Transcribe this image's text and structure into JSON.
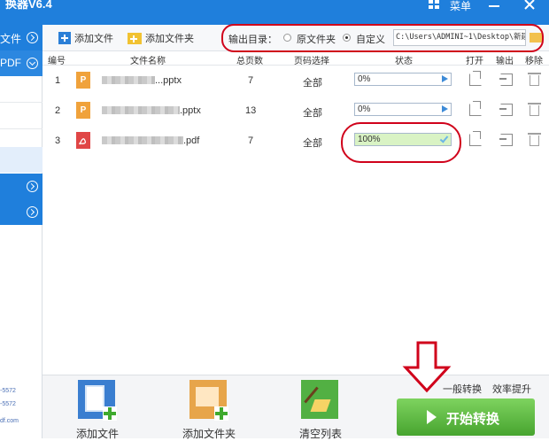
{
  "window": {
    "title_fragment": "换器V6.4",
    "menu_label": "菜单"
  },
  "sidebar": {
    "items": [
      {
        "label": "文件",
        "expand": "right"
      },
      {
        "label": "PDF",
        "expand": "down"
      }
    ],
    "collapsed_items": [
      {},
      {}
    ],
    "footer_lines": [
      "-5572",
      "-5572",
      "df.com"
    ]
  },
  "toolbar": {
    "add_file_label": "添加文件",
    "add_folder_label": "添加文件夹",
    "output_dir_label": "输出目录：",
    "option_source_folder": "原文件夹",
    "option_custom": "自定义",
    "output_path": "C:\\Users\\ADMINI~1\\Desktop\\新建文"
  },
  "table": {
    "headers": {
      "index": "编号",
      "filename": "文件名称",
      "pages": "总页数",
      "page_select": "页码选择",
      "status": "状态",
      "open": "打开",
      "export": "输出",
      "remove": "移除"
    },
    "rows": [
      {
        "index": "1",
        "type": "P",
        "name_suffix": "...pptx",
        "pages": "7",
        "page_select": "全部",
        "status": "0%",
        "progress": 0,
        "done": false
      },
      {
        "index": "2",
        "type": "P",
        "name_suffix": ".pptx",
        "pages": "13",
        "page_select": "全部",
        "status": "0%",
        "progress": 0,
        "done": false
      },
      {
        "index": "3",
        "type": "pdf",
        "name_suffix": ".pdf",
        "pages": "7",
        "page_select": "全部",
        "status": "100%",
        "progress": 100,
        "done": true
      }
    ]
  },
  "bottom": {
    "add_file_label": "添加文件",
    "add_folder_label": "添加文件夹",
    "clear_list_label": "清空列表",
    "mode_fast": "一般转换",
    "mode_efficient": "效率提升",
    "start_label": "开始转换"
  },
  "colors": {
    "titlebar": "#1f7fdc",
    "highlight_ring": "#d0021b",
    "start_button": "#5bbd3f"
  }
}
